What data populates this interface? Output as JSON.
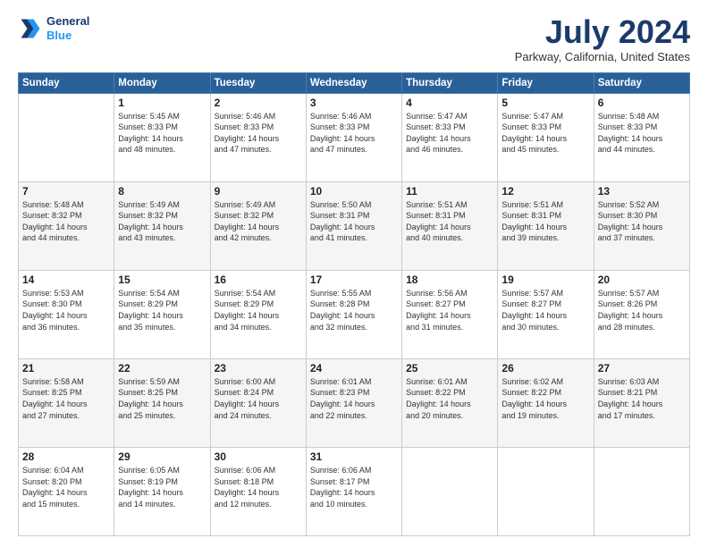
{
  "header": {
    "logo_line1": "General",
    "logo_line2": "Blue",
    "month_title": "July 2024",
    "location": "Parkway, California, United States"
  },
  "days_of_week": [
    "Sunday",
    "Monday",
    "Tuesday",
    "Wednesday",
    "Thursday",
    "Friday",
    "Saturday"
  ],
  "weeks": [
    [
      {
        "day": "",
        "content": ""
      },
      {
        "day": "1",
        "content": "Sunrise: 5:45 AM\nSunset: 8:33 PM\nDaylight: 14 hours\nand 48 minutes."
      },
      {
        "day": "2",
        "content": "Sunrise: 5:46 AM\nSunset: 8:33 PM\nDaylight: 14 hours\nand 47 minutes."
      },
      {
        "day": "3",
        "content": "Sunrise: 5:46 AM\nSunset: 8:33 PM\nDaylight: 14 hours\nand 47 minutes."
      },
      {
        "day": "4",
        "content": "Sunrise: 5:47 AM\nSunset: 8:33 PM\nDaylight: 14 hours\nand 46 minutes."
      },
      {
        "day": "5",
        "content": "Sunrise: 5:47 AM\nSunset: 8:33 PM\nDaylight: 14 hours\nand 45 minutes."
      },
      {
        "day": "6",
        "content": "Sunrise: 5:48 AM\nSunset: 8:33 PM\nDaylight: 14 hours\nand 44 minutes."
      }
    ],
    [
      {
        "day": "7",
        "content": "Sunrise: 5:48 AM\nSunset: 8:32 PM\nDaylight: 14 hours\nand 44 minutes."
      },
      {
        "day": "8",
        "content": "Sunrise: 5:49 AM\nSunset: 8:32 PM\nDaylight: 14 hours\nand 43 minutes."
      },
      {
        "day": "9",
        "content": "Sunrise: 5:49 AM\nSunset: 8:32 PM\nDaylight: 14 hours\nand 42 minutes."
      },
      {
        "day": "10",
        "content": "Sunrise: 5:50 AM\nSunset: 8:31 PM\nDaylight: 14 hours\nand 41 minutes."
      },
      {
        "day": "11",
        "content": "Sunrise: 5:51 AM\nSunset: 8:31 PM\nDaylight: 14 hours\nand 40 minutes."
      },
      {
        "day": "12",
        "content": "Sunrise: 5:51 AM\nSunset: 8:31 PM\nDaylight: 14 hours\nand 39 minutes."
      },
      {
        "day": "13",
        "content": "Sunrise: 5:52 AM\nSunset: 8:30 PM\nDaylight: 14 hours\nand 37 minutes."
      }
    ],
    [
      {
        "day": "14",
        "content": "Sunrise: 5:53 AM\nSunset: 8:30 PM\nDaylight: 14 hours\nand 36 minutes."
      },
      {
        "day": "15",
        "content": "Sunrise: 5:54 AM\nSunset: 8:29 PM\nDaylight: 14 hours\nand 35 minutes."
      },
      {
        "day": "16",
        "content": "Sunrise: 5:54 AM\nSunset: 8:29 PM\nDaylight: 14 hours\nand 34 minutes."
      },
      {
        "day": "17",
        "content": "Sunrise: 5:55 AM\nSunset: 8:28 PM\nDaylight: 14 hours\nand 32 minutes."
      },
      {
        "day": "18",
        "content": "Sunrise: 5:56 AM\nSunset: 8:27 PM\nDaylight: 14 hours\nand 31 minutes."
      },
      {
        "day": "19",
        "content": "Sunrise: 5:57 AM\nSunset: 8:27 PM\nDaylight: 14 hours\nand 30 minutes."
      },
      {
        "day": "20",
        "content": "Sunrise: 5:57 AM\nSunset: 8:26 PM\nDaylight: 14 hours\nand 28 minutes."
      }
    ],
    [
      {
        "day": "21",
        "content": "Sunrise: 5:58 AM\nSunset: 8:25 PM\nDaylight: 14 hours\nand 27 minutes."
      },
      {
        "day": "22",
        "content": "Sunrise: 5:59 AM\nSunset: 8:25 PM\nDaylight: 14 hours\nand 25 minutes."
      },
      {
        "day": "23",
        "content": "Sunrise: 6:00 AM\nSunset: 8:24 PM\nDaylight: 14 hours\nand 24 minutes."
      },
      {
        "day": "24",
        "content": "Sunrise: 6:01 AM\nSunset: 8:23 PM\nDaylight: 14 hours\nand 22 minutes."
      },
      {
        "day": "25",
        "content": "Sunrise: 6:01 AM\nSunset: 8:22 PM\nDaylight: 14 hours\nand 20 minutes."
      },
      {
        "day": "26",
        "content": "Sunrise: 6:02 AM\nSunset: 8:22 PM\nDaylight: 14 hours\nand 19 minutes."
      },
      {
        "day": "27",
        "content": "Sunrise: 6:03 AM\nSunset: 8:21 PM\nDaylight: 14 hours\nand 17 minutes."
      }
    ],
    [
      {
        "day": "28",
        "content": "Sunrise: 6:04 AM\nSunset: 8:20 PM\nDaylight: 14 hours\nand 15 minutes."
      },
      {
        "day": "29",
        "content": "Sunrise: 6:05 AM\nSunset: 8:19 PM\nDaylight: 14 hours\nand 14 minutes."
      },
      {
        "day": "30",
        "content": "Sunrise: 6:06 AM\nSunset: 8:18 PM\nDaylight: 14 hours\nand 12 minutes."
      },
      {
        "day": "31",
        "content": "Sunrise: 6:06 AM\nSunset: 8:17 PM\nDaylight: 14 hours\nand 10 minutes."
      },
      {
        "day": "",
        "content": ""
      },
      {
        "day": "",
        "content": ""
      },
      {
        "day": "",
        "content": ""
      }
    ]
  ]
}
